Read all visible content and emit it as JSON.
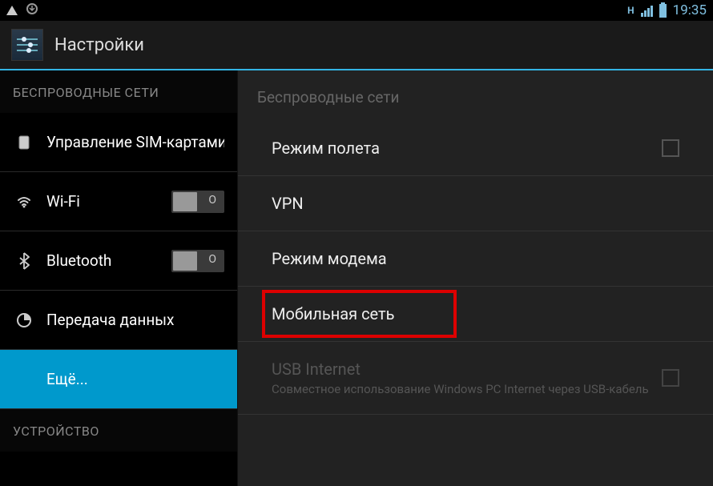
{
  "status_bar": {
    "time": "19:35"
  },
  "header": {
    "title": "Настройки"
  },
  "sidebar": {
    "section1_title": "Беспроводные сети",
    "items": [
      {
        "label": "Управление SIM-картами"
      },
      {
        "label": "Wi-Fi"
      },
      {
        "label": "Bluetooth"
      },
      {
        "label": "Передача данных"
      },
      {
        "label": "Ещё..."
      }
    ],
    "section2_title": "Устройство"
  },
  "detail": {
    "section_title": "Беспроводные сети",
    "items": [
      {
        "label": "Режим полета"
      },
      {
        "label": "VPN"
      },
      {
        "label": "Режим модема"
      },
      {
        "label": "Мобильная сеть"
      },
      {
        "label": "USB Internet",
        "subtitle": "Совместное использование Windows PC Internet через USB-кабель"
      }
    ]
  }
}
